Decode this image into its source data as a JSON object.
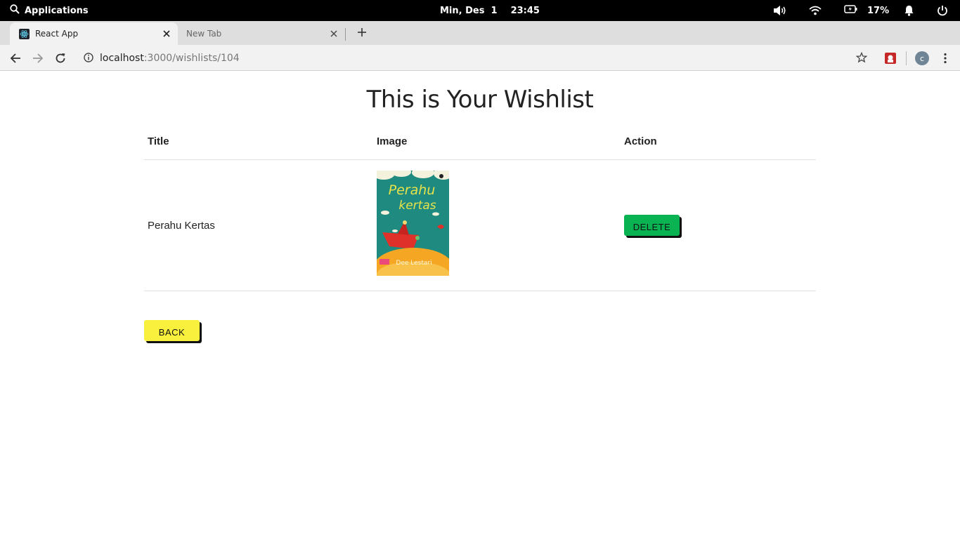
{
  "system_panel": {
    "applications_label": "Applications",
    "date": "Min, Des  1",
    "time": "23:45",
    "battery": "17%"
  },
  "browser": {
    "tabs": [
      {
        "label": "React App",
        "active": true
      },
      {
        "label": "New Tab",
        "active": false
      }
    ],
    "url_host": "localhost",
    "url_path": ":3000/wishlists/104",
    "profile_initial": "c"
  },
  "page": {
    "title": "This is Your Wishlist",
    "table": {
      "headers": [
        "Title",
        "Image",
        "Action"
      ],
      "rows": [
        {
          "title": "Perahu Kertas",
          "image_caption": "Perahu kertas",
          "image_author": "Dee Lestari",
          "action_label": "DELETE"
        }
      ]
    },
    "back_label": "BACK"
  },
  "colors": {
    "delete_button": "#0ab352",
    "back_button": "#f9f03e",
    "panel_bg": "#000000",
    "book_teal": "#1e8a80",
    "book_orange": "#f5a623"
  },
  "icons": [
    "search-icon",
    "volume-icon",
    "wifi-icon",
    "battery-icon",
    "bell-icon",
    "power-icon",
    "react-icon",
    "close-icon",
    "plus-icon",
    "back-arrow-icon",
    "forward-arrow-icon",
    "reload-icon",
    "info-icon",
    "star-icon",
    "extension-icon",
    "menu-dots-icon"
  ]
}
